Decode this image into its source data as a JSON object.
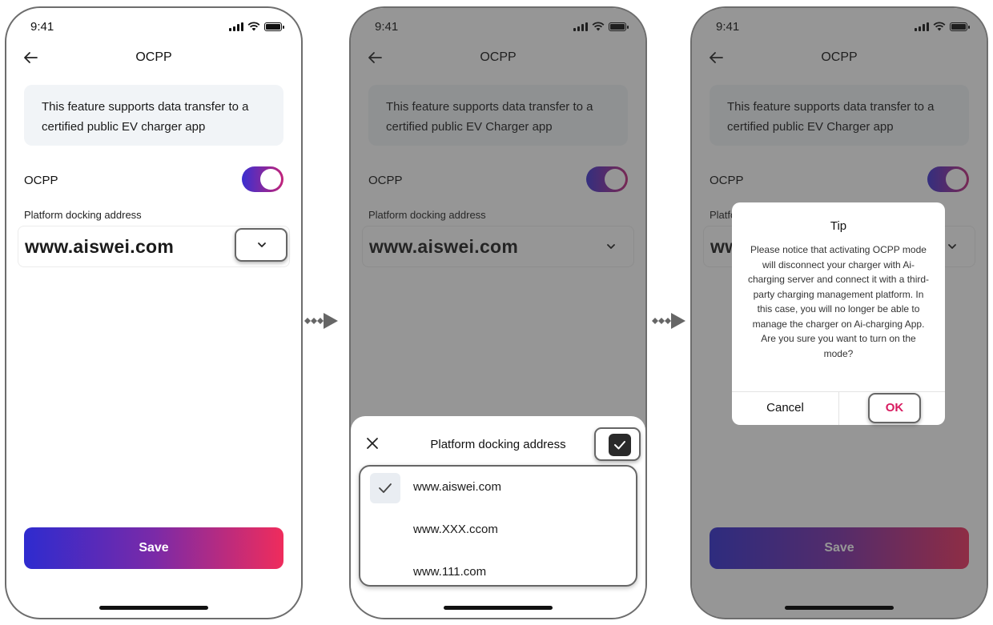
{
  "status_time": "9:41",
  "nav_title": "OCPP",
  "notice_1": "This feature supports data transfer to a certified public EV charger app",
  "notice_2": "This feature supports data transfer to a certified public EV Charger app",
  "ocpp_label": "OCPP",
  "ocpp_enabled": true,
  "address_label": "Platform docking address",
  "address_value": "www.aiswei.com",
  "save_label": "Save",
  "sheet": {
    "title": "Platform docking address",
    "options": [
      "www.aiswei.com",
      "www.XXX.ccom",
      "www.111.com"
    ],
    "selected_index": 0
  },
  "dialog": {
    "title": "Tip",
    "body": "Please notice that activating OCPP mode will disconnect your charger with Ai-charging server and connect it with a third-party charging management platform. In this case, you will no longer be able to manage the charger on Ai-charging App. Are you sure you want to turn on the mode?",
    "cancel": "Cancel",
    "ok": "OK"
  },
  "colors": {
    "toggle_gradient": [
      "#3a2fd0",
      "#c2247a"
    ],
    "save_gradient": [
      "#2e2bcf",
      "#7a2aa8",
      "#ef2c5c"
    ],
    "ok_text": "#d81b60"
  },
  "icons": [
    "back-arrow-icon",
    "chevron-down-icon",
    "close-icon",
    "checkmark-icon",
    "signal-icon",
    "wifi-icon",
    "battery-icon",
    "flow-arrow-icon"
  ]
}
